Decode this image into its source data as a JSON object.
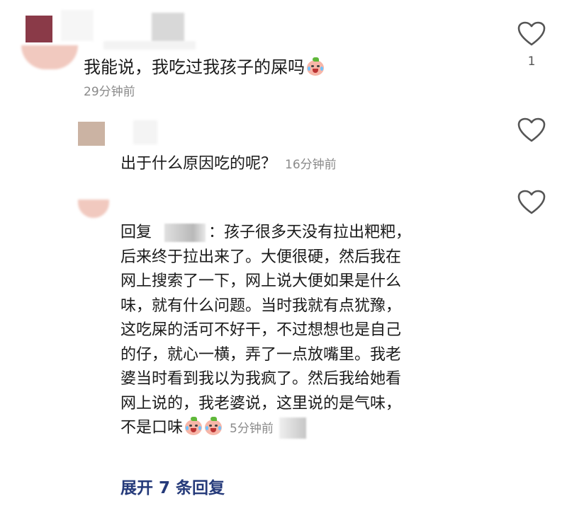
{
  "comments": [
    {
      "text": "我能说，我吃过我孩子的屎吗",
      "time": "29分钟前",
      "like_count": "1"
    },
    {
      "text": "出于什么原因吃的呢？",
      "time": "16分钟前"
    },
    {
      "reply_prefix": "回复",
      "reply_sep": "：孩子很多天没有拉出粑粑，",
      "lines": [
        "后来终于拉出来了。大便很硬，然后我在",
        "网上搜索了一下，网上说大便如果是什么",
        "味，就有什么问题。当时我就有点犹豫，",
        "这吃屎的活可不好干，不过想想也是自己",
        "的仔，就心一横，弄了一点放嘴里。我老",
        "婆当时看到我以为我疯了。然后我给她看",
        "网上说的，我老婆说，这里说的是气味，"
      ],
      "last_line": "不是口味",
      "time": "5分钟前"
    }
  ],
  "expand_replies": "展开 7 条回复",
  "icons": {
    "like": "heart-outline-icon",
    "emoji": "crying-laugh-emoji-icon"
  }
}
